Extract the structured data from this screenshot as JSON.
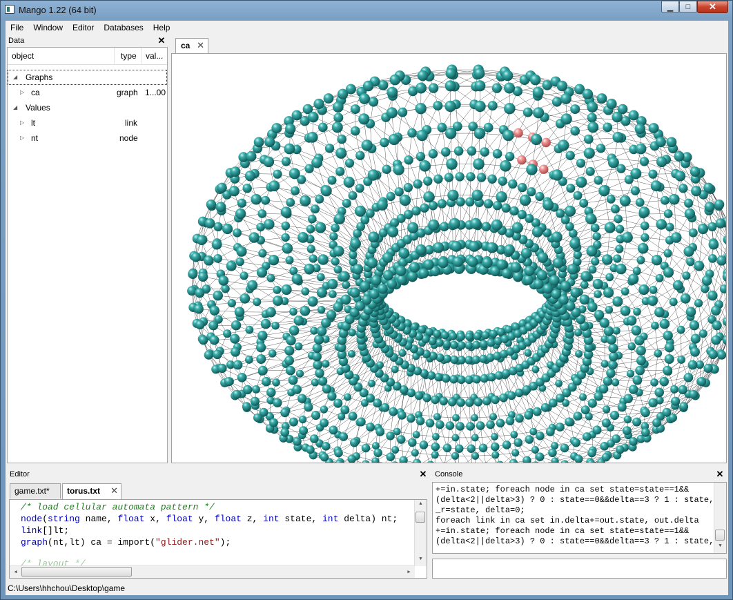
{
  "window": {
    "title": "Mango 1.22 (64 bit)",
    "minimize": "▁",
    "maximize": "□",
    "close": "✕"
  },
  "menu": [
    "File",
    "Window",
    "Editor",
    "Databases",
    "Help"
  ],
  "data_panel": {
    "title": "Data",
    "columns": [
      "object",
      "type",
      "val..."
    ],
    "rows": [
      {
        "arrow": "◢",
        "name": "Graphs",
        "type": "",
        "value": ""
      },
      {
        "arrow": "▷",
        "name": "ca",
        "type": "graph",
        "value": "1...00"
      },
      {
        "arrow": "◢",
        "name": "Values",
        "type": "",
        "value": ""
      },
      {
        "arrow": "▷",
        "name": "lt",
        "type": "link",
        "value": ""
      },
      {
        "arrow": "▷",
        "name": "nt",
        "type": "node",
        "value": ""
      }
    ]
  },
  "view": {
    "tab": "ca",
    "tab_close": "✕"
  },
  "editor": {
    "title": "Editor",
    "tabs": [
      "game.txt*",
      "torus.txt"
    ],
    "tab_close": "✕",
    "code": {
      "l1": "/* load cellular automata pattern */",
      "l2_fn": "node",
      "l2_a": "(",
      "l2_t1": "string",
      "l2_b": " name, ",
      "l2_t2": "float",
      "l2_c": " x, ",
      "l2_t3": "float",
      "l2_d": " y, ",
      "l2_t4": "float",
      "l2_e": " z, ",
      "l2_t5": "int",
      "l2_f": " state, ",
      "l2_t6": "int",
      "l2_g": " delta) nt;",
      "l3_fn": "link",
      "l3_rest": "[]lt;",
      "l4_fn": "graph",
      "l4_a": "(nt,lt) ca = import(",
      "l4_str": "\"glider.net\"",
      "l4_b": ");",
      "l5": "/* layout */"
    }
  },
  "console": {
    "title": "Console",
    "lines": [
      "+=in.state; foreach node in ca set state=state==1&&",
      "(delta<2||delta>3) ? 0 : state==0&&delta==3 ? 1 : state,",
      "_r=state, delta=0;",
      "foreach link in ca set in.delta+=out.state, out.delta",
      "+=in.state; foreach node in ca set state=state==1&&",
      "(delta<2||delta>3) ? 0 : state==0&&delta==3 ? 1 : state,"
    ]
  },
  "status": "C:\\Users\\hhchou\\Desktop\\game",
  "colors": {
    "node": "#1f8c8a",
    "node_highlight": "#c9c0f0",
    "active_node": "#ef8d8d"
  }
}
